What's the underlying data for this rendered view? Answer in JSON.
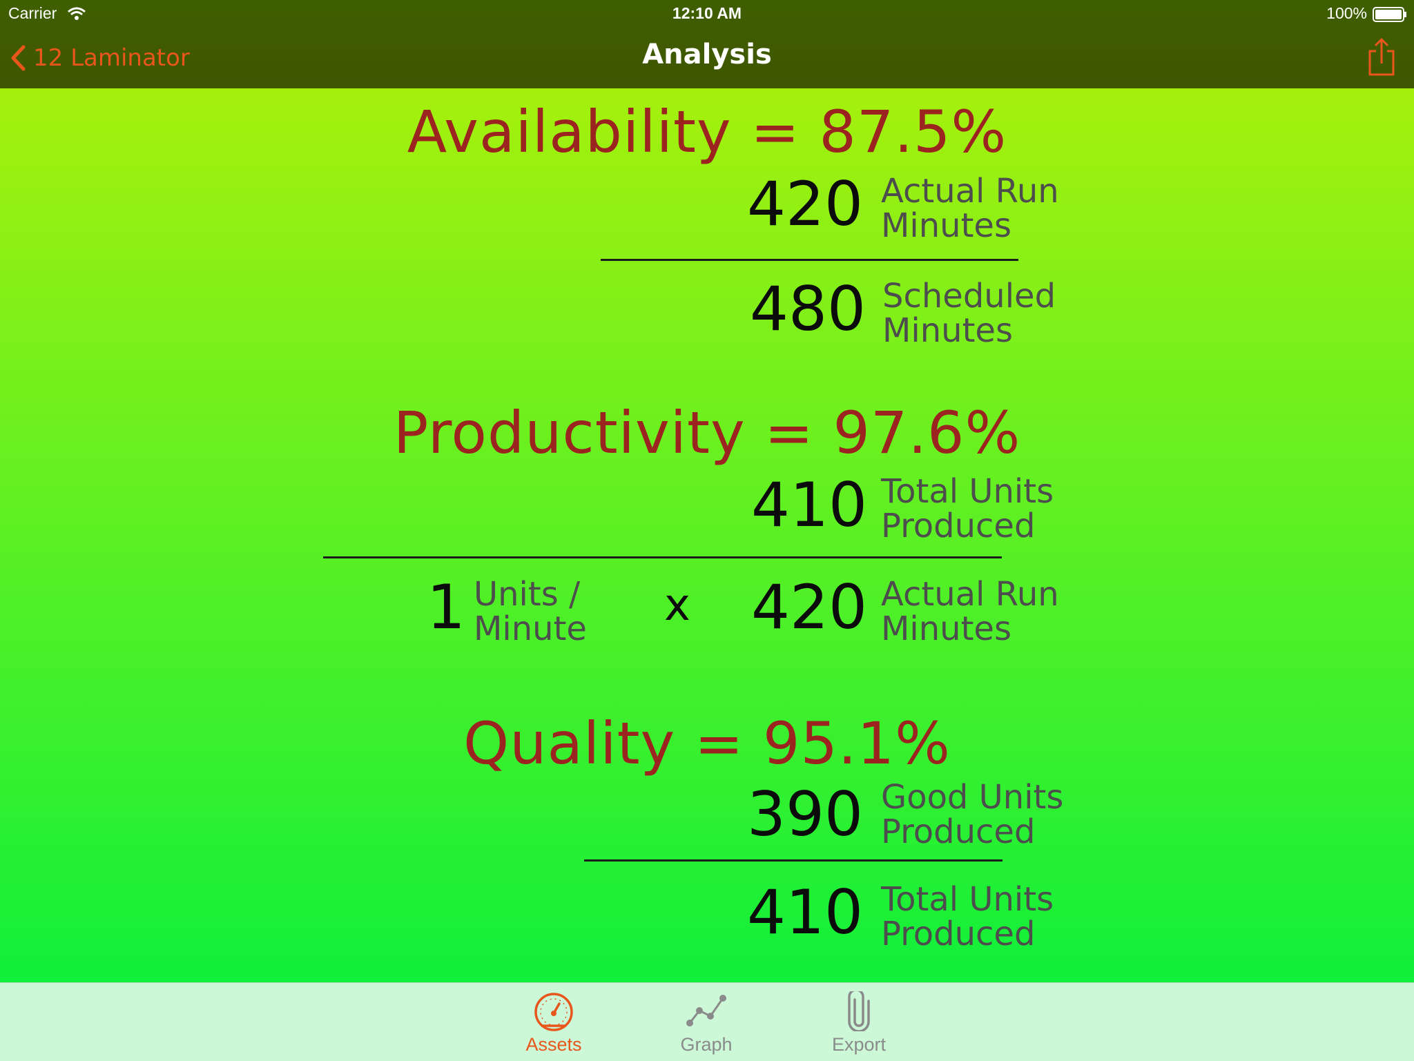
{
  "status_bar": {
    "carrier": "Carrier",
    "time": "12:10 AM",
    "battery": "100%"
  },
  "nav": {
    "back_label": "12 Laminator",
    "title": "Analysis",
    "share_icon": "share-icon"
  },
  "colors": {
    "heading": "#9c2420",
    "accent": "#e8561c",
    "nav_bg": "#3f5a00",
    "gradient_top": "#a6f00d",
    "gradient_bottom": "#10f03a"
  },
  "availability": {
    "heading": "Availability = 87.5%",
    "numerator_value": "420",
    "numerator_label": "Actual Run\nMinutes",
    "denominator_value": "480",
    "denominator_label": "Scheduled\nMinutes"
  },
  "productivity": {
    "heading": "Productivity = 97.6%",
    "numerator_value": "410",
    "numerator_label": "Total Units\nProduced",
    "rate_value": "1",
    "rate_label": "Units /\nMinute",
    "times": "x",
    "run_value": "420",
    "run_label": "Actual Run\nMinutes"
  },
  "quality": {
    "heading": "Quality = 95.1%",
    "numerator_value": "390",
    "numerator_label": "Good Units\nProduced",
    "denominator_value": "410",
    "denominator_label": "Total Units\nProduced"
  },
  "tabs": [
    {
      "label": "Assets",
      "icon": "gauge-icon",
      "selected": true
    },
    {
      "label": "Graph",
      "icon": "graph-icon",
      "selected": false
    },
    {
      "label": "Export",
      "icon": "paperclip-icon",
      "selected": false
    }
  ]
}
